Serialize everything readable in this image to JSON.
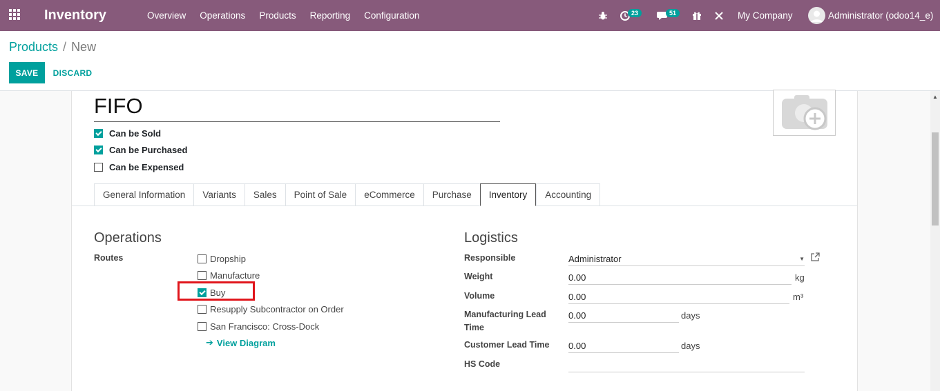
{
  "navbar": {
    "brand": "Inventory",
    "menu": [
      "Overview",
      "Operations",
      "Products",
      "Reporting",
      "Configuration"
    ],
    "activity_count": "23",
    "messages_count": "51",
    "company": "My Company",
    "user": "Administrator (odoo14_e)"
  },
  "breadcrumb": {
    "parent": "Products",
    "separator": "/",
    "current": "New"
  },
  "buttons": {
    "save": "SAVE",
    "discard": "DISCARD"
  },
  "product": {
    "name": "FIFO",
    "flags": [
      {
        "label": "Can be Sold",
        "checked": true
      },
      {
        "label": "Can be Purchased",
        "checked": true
      },
      {
        "label": "Can be Expensed",
        "checked": false
      }
    ]
  },
  "tabs": [
    "General Information",
    "Variants",
    "Sales",
    "Point of Sale",
    "eCommerce",
    "Purchase",
    "Inventory",
    "Accounting"
  ],
  "active_tab": "Inventory",
  "operations": {
    "title": "Operations",
    "routes_label": "Routes",
    "routes": [
      {
        "label": "Dropship",
        "checked": false
      },
      {
        "label": "Manufacture",
        "checked": false
      },
      {
        "label": "Buy",
        "checked": true
      },
      {
        "label": "Resupply Subcontractor on Order",
        "checked": false
      },
      {
        "label": "San Francisco: Cross-Dock",
        "checked": false
      }
    ],
    "view_diagram": "View Diagram"
  },
  "logistics": {
    "title": "Logistics",
    "responsible_label": "Responsible",
    "responsible_value": "Administrator",
    "weight_label": "Weight",
    "weight_value": "0.00",
    "weight_unit": "kg",
    "volume_label": "Volume",
    "volume_value": "0.00",
    "volume_unit": "m³",
    "mfg_lead_label": "Manufacturing Lead Time",
    "mfg_lead_value": "0.00",
    "mfg_lead_unit": "days",
    "cust_lead_label": "Customer Lead Time",
    "cust_lead_value": "0.00",
    "cust_lead_unit": "days",
    "hs_code_label": "HS Code",
    "hs_code_value": ""
  },
  "colors": {
    "navbar": "#875a7b",
    "accent": "#00a09d",
    "highlight": "#e0151b"
  }
}
